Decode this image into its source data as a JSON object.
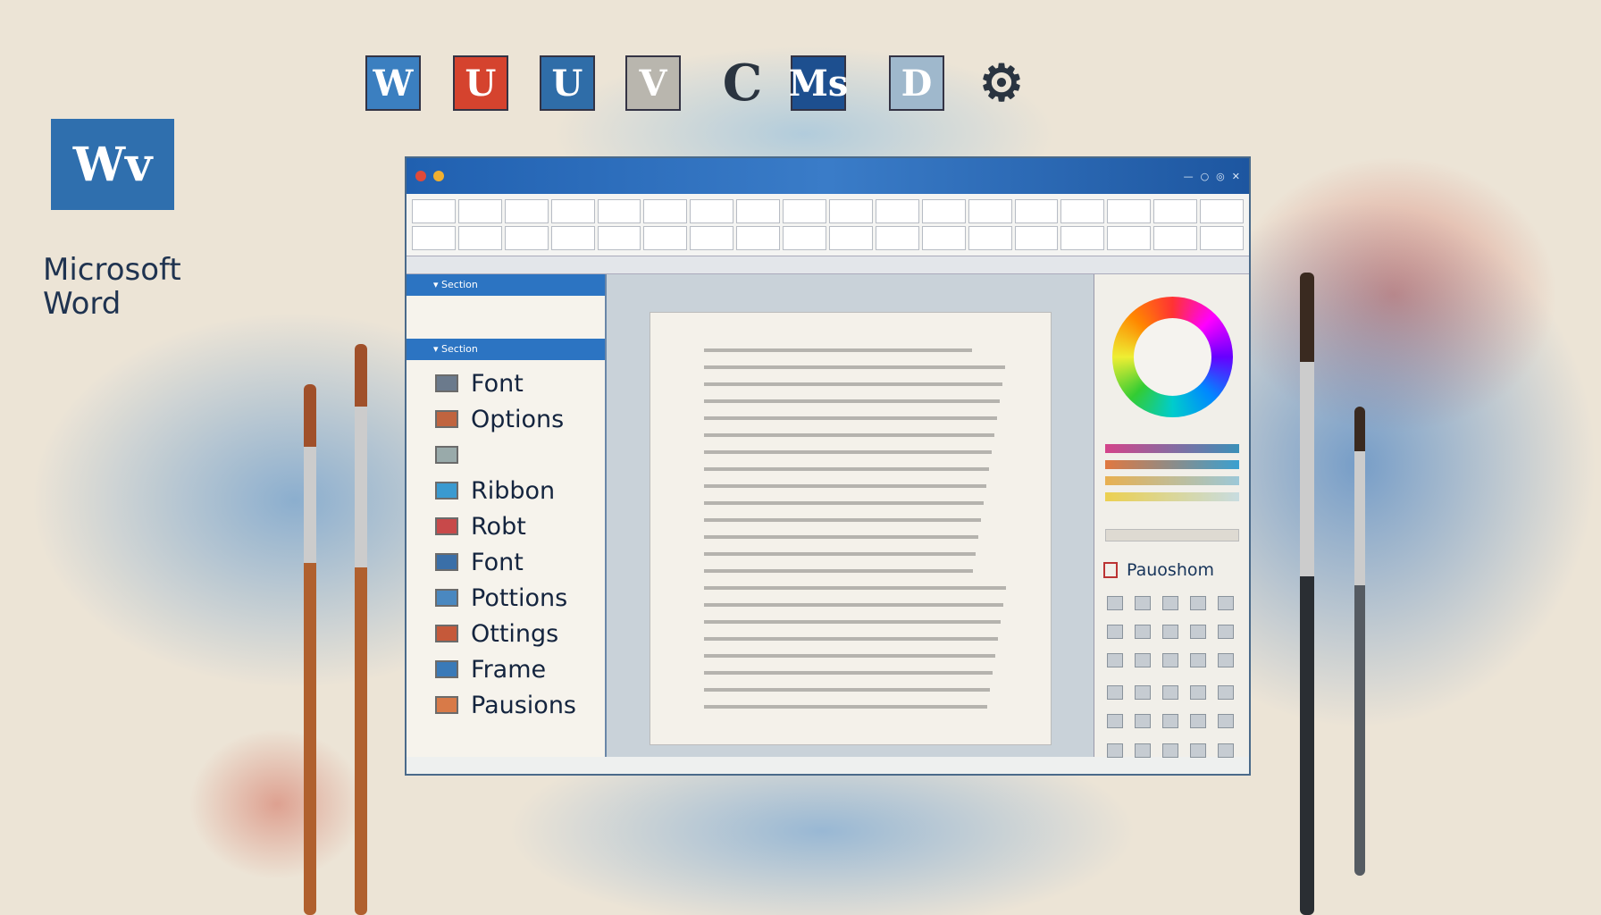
{
  "logo": {
    "mark": "Wv",
    "line1": "Microsoft",
    "line2": "Word"
  },
  "top_icons": [
    {
      "name": "word-icon",
      "glyph": "W",
      "color": "#3b7fc0"
    },
    {
      "name": "red-app-icon",
      "glyph": "U",
      "color": "#d5432e"
    },
    {
      "name": "blue-app-icon",
      "glyph": "U",
      "color": "#2f6da8"
    },
    {
      "name": "grey-app-icon",
      "glyph": "V",
      "color": "#b9b6ae"
    },
    {
      "name": "c-icon",
      "glyph": "C",
      "color": "transparent"
    },
    {
      "name": "ms-icon",
      "glyph": "Ms",
      "color": "#1d4f8f"
    },
    {
      "name": "d-icon",
      "glyph": "D",
      "color": "#9fb8cc"
    },
    {
      "name": "gear-icon",
      "glyph": "⚙",
      "color": "transparent"
    }
  ],
  "left_pane": {
    "headers": [
      "▾ Section",
      "▾ Section"
    ],
    "items": [
      {
        "label": "Font",
        "color": "#6b7a8c"
      },
      {
        "label": "Options",
        "color": "#c0643f"
      },
      {
        "label": "",
        "color": "#9aa"
      },
      {
        "label": "Ribbon",
        "color": "#3a9ad0"
      },
      {
        "label": "Robt",
        "color": "#c8494a"
      },
      {
        "label": "Font",
        "color": "#3a6fa8"
      },
      {
        "label": "Pottions",
        "color": "#4a88c0"
      },
      {
        "label": "Ottings",
        "color": "#c5593a"
      },
      {
        "label": "Frame",
        "color": "#3a7ab8"
      },
      {
        "label": "Pausions",
        "color": "#d87a48"
      }
    ]
  },
  "right_pane": {
    "label": "Pauoshom"
  },
  "colors": {
    "accent": "#2c74c2",
    "title_bar": "#2060b0"
  }
}
